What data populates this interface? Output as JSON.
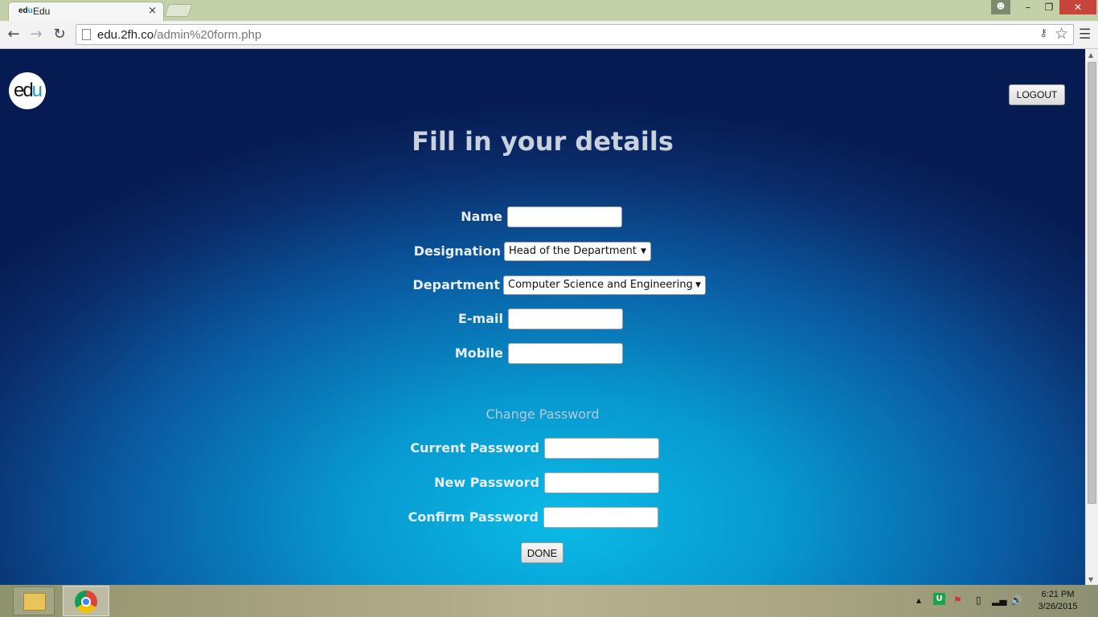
{
  "browser": {
    "tab_title": "Edu",
    "tab_favicon_text": "edu",
    "tab_close": "×",
    "url_host": "edu.2fh.co",
    "url_path": "/admin%20form.php",
    "window_controls": {
      "minimize": "–",
      "maximize": "❐",
      "close": "✕"
    }
  },
  "page": {
    "logo_text_d": "ed",
    "logo_text_u": "u",
    "logout_label": "LOGOUT",
    "heading": "Fill in your details",
    "fields": {
      "name_label": "Name",
      "designation_label": "Designation",
      "designation_value": "Head of the Department",
      "department_label": "Department",
      "department_value": "Computer Science and Engineering",
      "email_label": "E-mail",
      "mobile_label": "Mobile"
    },
    "password_section": {
      "title": "Change Password",
      "current_label": "Current Password",
      "new_label": "New Password",
      "confirm_label": "Confirm Password"
    },
    "done_label": "DONE"
  },
  "taskbar": {
    "time": "6:21 PM",
    "date": "3/26/2015"
  },
  "colors": {
    "page_gradient_center": "#0bbbe6",
    "page_gradient_edge": "#061b52",
    "heading_text": "#c9d2dc",
    "label_text": "#e8eef4",
    "titlebar": "#c4d1a8",
    "close_button": "#c7443b"
  }
}
